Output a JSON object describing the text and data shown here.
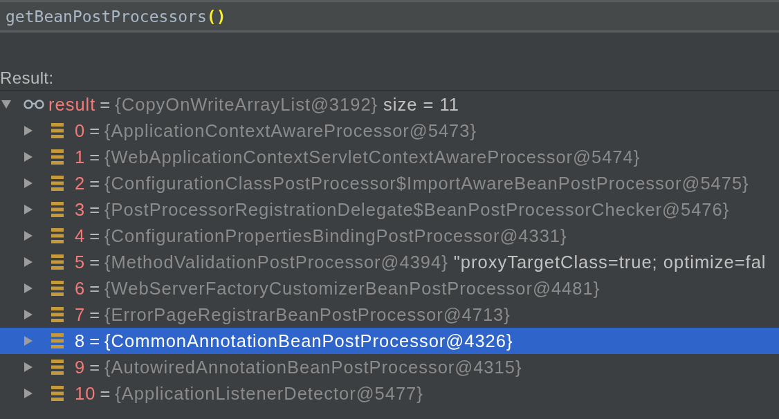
{
  "expression_field": {
    "tokens": [
      {
        "text": "getBeanPostProcessors",
        "kind": "identifier"
      },
      {
        "text": "()",
        "kind": "matched-brace"
      }
    ]
  },
  "result_label": "Result:",
  "tree": [
    {
      "kind": "watch",
      "name": "result",
      "operator": "=",
      "value": "{CopyOnWriteArrayList@3192}",
      "detail": "size = 11",
      "expanded": true,
      "selected": false,
      "children": [
        {
          "kind": "element",
          "name": "0",
          "operator": "=",
          "value": "{ApplicationContextAwareProcessor@5473}",
          "expanded": false,
          "selected": false
        },
        {
          "kind": "element",
          "name": "1",
          "operator": "=",
          "value": "{WebApplicationContextServletContextAwareProcessor@5474}",
          "expanded": false,
          "selected": false
        },
        {
          "kind": "element",
          "name": "2",
          "operator": "=",
          "value": "{ConfigurationClassPostProcessor$ImportAwareBeanPostProcessor@5475}",
          "expanded": false,
          "selected": false
        },
        {
          "kind": "element",
          "name": "3",
          "operator": "=",
          "value": "{PostProcessorRegistrationDelegate$BeanPostProcessorChecker@5476}",
          "expanded": false,
          "selected": false
        },
        {
          "kind": "element",
          "name": "4",
          "operator": "=",
          "value": "{ConfigurationPropertiesBindingPostProcessor@4331}",
          "expanded": false,
          "selected": false
        },
        {
          "kind": "element",
          "name": "5",
          "operator": "=",
          "value": "{MethodValidationPostProcessor@4394}",
          "detail": "\"proxyTargetClass=true; optimize=fal",
          "expanded": false,
          "selected": false
        },
        {
          "kind": "element",
          "name": "6",
          "operator": "=",
          "value": "{WebServerFactoryCustomizerBeanPostProcessor@4481}",
          "expanded": false,
          "selected": false
        },
        {
          "kind": "element",
          "name": "7",
          "operator": "=",
          "value": "{ErrorPageRegistrarBeanPostProcessor@4713}",
          "expanded": false,
          "selected": false
        },
        {
          "kind": "element",
          "name": "8",
          "operator": "=",
          "value": "{CommonAnnotationBeanPostProcessor@4326}",
          "expanded": false,
          "selected": true
        },
        {
          "kind": "element",
          "name": "9",
          "operator": "=",
          "value": "{AutowiredAnnotationBeanPostProcessor@4315}",
          "expanded": false,
          "selected": false
        },
        {
          "kind": "element",
          "name": "10",
          "operator": "=",
          "value": "{ApplicationListenerDetector@5477}",
          "expanded": false,
          "selected": false
        }
      ]
    }
  ]
}
